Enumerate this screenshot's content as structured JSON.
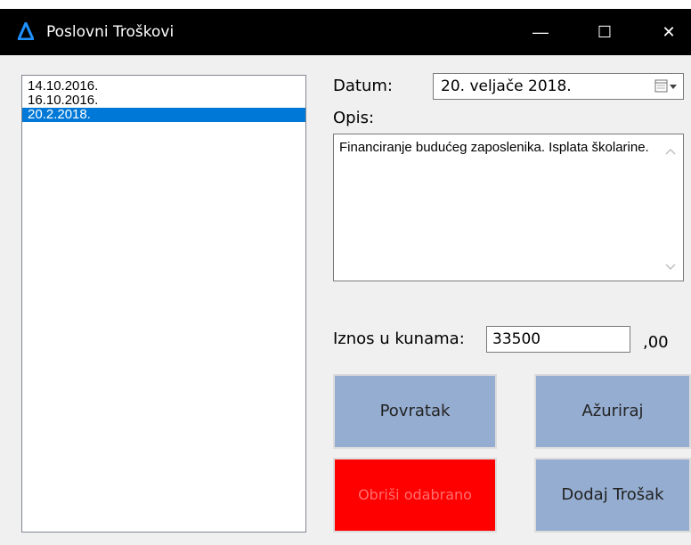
{
  "window": {
    "title": "Poslovni Troškovi",
    "minimize": "—",
    "maximize": "☐",
    "close": "✕"
  },
  "list": {
    "items": [
      "14.10.2016.",
      "16.10.2016.",
      "20.2.2018."
    ],
    "selected_index": 2
  },
  "form": {
    "date_label": "Datum:",
    "date_value": "20.  veljače  2018.",
    "description_label": "Opis:",
    "description_value": "Financiranje budućeg zaposlenika. Isplata školarine.",
    "amount_label": "Iznos u kunama:",
    "amount_value": "33500",
    "amount_suffix": ",00"
  },
  "buttons": {
    "back": "Povratak",
    "update": "Ažuriraj",
    "delete": "Obriši odabrano",
    "add": "Dodaj Trošak"
  },
  "colors": {
    "selection": "#0078d7",
    "button_blue": "#95add0",
    "button_red": "#ff0000",
    "accent_icon": "#1e90ff"
  }
}
